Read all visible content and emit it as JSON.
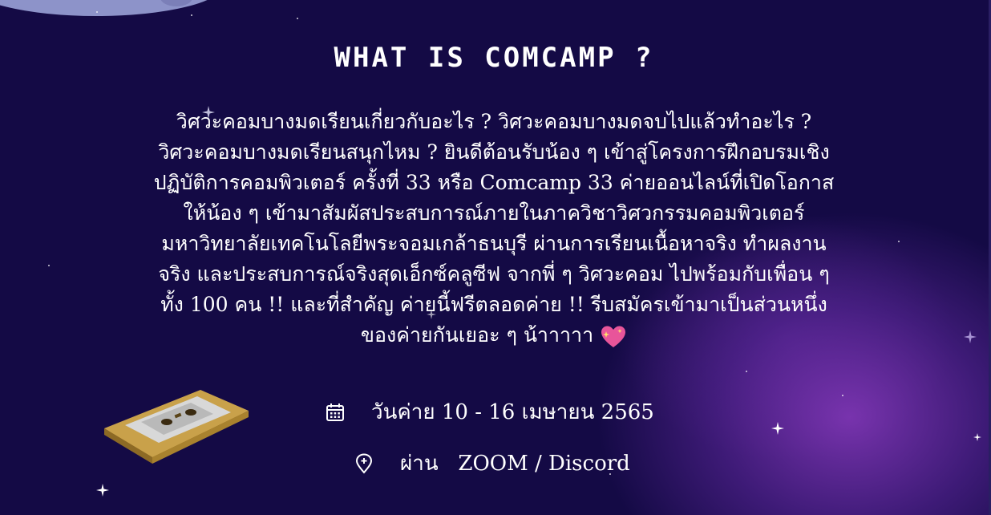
{
  "section": {
    "title": "WHAT IS COMCAMP ?",
    "description": "วิศวะคอมบางมดเรียนเกี่ยวกับอะไร ? วิศวะคอมบางมดจบไปแล้วทำอะไร ? วิศวะคอมบางมดเรียนสนุกไหม ? ยินดีต้อนรับน้อง ๆ เข้าสู่โครงการฝึกอบรมเชิงปฏิบัติการคอมพิวเตอร์ ครั้งที่ 33 หรือ Comcamp 33 ค่ายออนไลน์ที่เปิดโอกาสให้น้อง ๆ เข้ามาสัมผัสประสบการณ์ภายในภาควิชาวิศวกรรมคอมพิวเตอร์ มหาวิทยาลัยเทคโนโลยีพระจอมเกล้าธนบุรี ผ่านการเรียนเนื้อหาจริง ทำผลงานจริง และประสบการณ์จริงสุดเอ็กซ์คลูซีฟ จากพี่ ๆ วิศวะคอม ไปพร้อมกับเพื่อน ๆ ทั้ง 100 คน !! และที่สำคัญ ค่ายนี้ฟรีตลอดค่าย !! รีบสมัครเข้ามาเป็นส่วนหนึ่งของค่ายกันเยอะ ๆ น้าาาาา"
  },
  "info": {
    "date_text": "วันค่าย 10 - 16 เมษายน 2565",
    "place_text": "ผ่าน   ZOOM / Discord"
  },
  "icons": {
    "date": "calendar-icon",
    "place": "location-pin-icon",
    "emoji": "sparkling-heart-icon",
    "decoration": "cassette-tape-icon"
  },
  "colors": {
    "background": "#140a45",
    "glow": "#883abe",
    "text": "#ffffff"
  }
}
